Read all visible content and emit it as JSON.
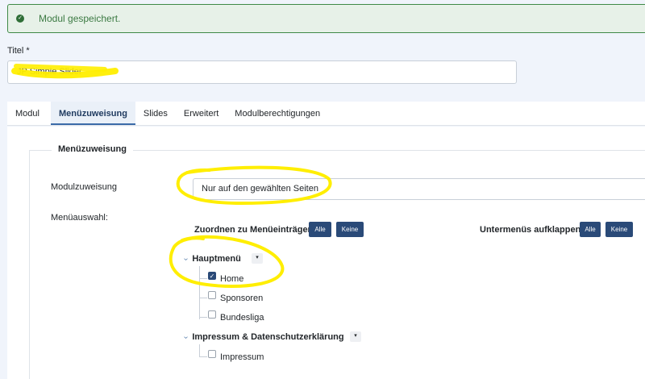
{
  "alert": {
    "message": "Modul gespeichert.",
    "icon": "check-circle-icon",
    "color": "#3c7a43"
  },
  "title_field": {
    "label": "Titel *",
    "value": "JP Simple Slider"
  },
  "tabs": [
    {
      "label": "Modul"
    },
    {
      "label": "Menüzuweisung",
      "active": true
    },
    {
      "label": "Slides"
    },
    {
      "label": "Erweitert"
    },
    {
      "label": "Modulberechtigungen"
    }
  ],
  "menu_assignment": {
    "legend": "Menüzuweisung",
    "module_assignment_label": "Modulzuweisung",
    "module_assignment_value": "Nur auf den gewählten Seiten",
    "menu_selection_label": "Menüauswahl:",
    "assign_header": "Zuordnen zu Menüeinträgen",
    "expand_header": "Untermenüs aufklappen",
    "btn_all": "Alle",
    "btn_none": "Keine",
    "menus": [
      {
        "name": "Hauptmenü",
        "items": [
          {
            "label": "Home",
            "checked": true
          },
          {
            "label": "Sponsoren",
            "checked": false
          },
          {
            "label": "Bundesliga",
            "checked": false
          }
        ]
      },
      {
        "name": "Impressum & Datenschutzerklärung",
        "items": [
          {
            "label": "Impressum",
            "checked": false
          }
        ]
      }
    ]
  },
  "colors": {
    "accent": "#2a4a78",
    "highlight": "#ffee00",
    "success_border": "#3f8a47"
  }
}
